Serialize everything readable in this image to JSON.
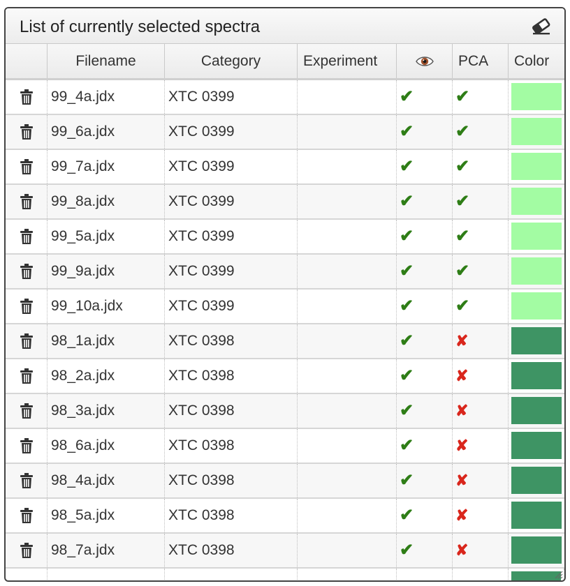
{
  "panel": {
    "title": "List of currently selected spectra",
    "clear_icon": "eraser-icon"
  },
  "columns": {
    "delete": "",
    "filename": "Filename",
    "category": "Category",
    "experiment": "Experiment",
    "visible_icon": "eye-icon",
    "pca": "PCA",
    "color": "Color"
  },
  "colors": {
    "light_green": "#a3fca3",
    "dark_green": "#3e9464",
    "check": "#2e7d16",
    "cross": "#d9261c"
  },
  "symbols": {
    "check": "✔",
    "cross": "✘"
  },
  "rows": [
    {
      "filename": "99_4a.jdx",
      "category": "XTC 0399",
      "experiment": "",
      "visible": true,
      "pca": true,
      "color": "#a3fca3"
    },
    {
      "filename": "99_6a.jdx",
      "category": "XTC 0399",
      "experiment": "",
      "visible": true,
      "pca": true,
      "color": "#a3fca3"
    },
    {
      "filename": "99_7a.jdx",
      "category": "XTC 0399",
      "experiment": "",
      "visible": true,
      "pca": true,
      "color": "#a3fca3"
    },
    {
      "filename": "99_8a.jdx",
      "category": "XTC 0399",
      "experiment": "",
      "visible": true,
      "pca": true,
      "color": "#a3fca3"
    },
    {
      "filename": "99_5a.jdx",
      "category": "XTC 0399",
      "experiment": "",
      "visible": true,
      "pca": true,
      "color": "#a3fca3"
    },
    {
      "filename": "99_9a.jdx",
      "category": "XTC 0399",
      "experiment": "",
      "visible": true,
      "pca": true,
      "color": "#a3fca3"
    },
    {
      "filename": "99_10a.jdx",
      "category": "XTC 0399",
      "experiment": "",
      "visible": true,
      "pca": true,
      "color": "#a3fca3"
    },
    {
      "filename": "98_1a.jdx",
      "category": "XTC 0398",
      "experiment": "",
      "visible": true,
      "pca": false,
      "color": "#3e9464"
    },
    {
      "filename": "98_2a.jdx",
      "category": "XTC 0398",
      "experiment": "",
      "visible": true,
      "pca": false,
      "color": "#3e9464"
    },
    {
      "filename": "98_3a.jdx",
      "category": "XTC 0398",
      "experiment": "",
      "visible": true,
      "pca": false,
      "color": "#3e9464"
    },
    {
      "filename": "98_6a.jdx",
      "category": "XTC 0398",
      "experiment": "",
      "visible": true,
      "pca": false,
      "color": "#3e9464"
    },
    {
      "filename": "98_4a.jdx",
      "category": "XTC 0398",
      "experiment": "",
      "visible": true,
      "pca": false,
      "color": "#3e9464"
    },
    {
      "filename": "98_5a.jdx",
      "category": "XTC 0398",
      "experiment": "",
      "visible": true,
      "pca": false,
      "color": "#3e9464"
    },
    {
      "filename": "98_7a.jdx",
      "category": "XTC 0398",
      "experiment": "",
      "visible": true,
      "pca": false,
      "color": "#3e9464"
    }
  ],
  "partial_row": {
    "color": "#3e9464"
  }
}
